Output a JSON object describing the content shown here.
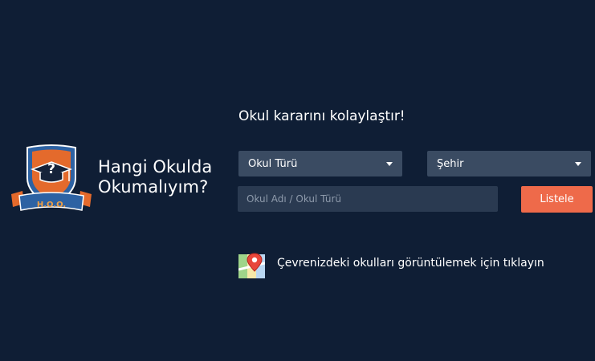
{
  "brand": {
    "logo_icon": "school-crest-logo-icon",
    "logo_text": "H.O.O.",
    "line1": "Hangi Okulda",
    "line2": "Okumalıyım?"
  },
  "search": {
    "tagline": "Okul kararını kolaylaştır!",
    "type_select_value": "Okul Türü",
    "city_select_value": "Şehir",
    "name_placeholder": "Okul Adı / Okul Türü",
    "submit_label": "Listele"
  },
  "nearby": {
    "icon": "map-pin-icon",
    "link_text": "Çevrenizdeki okulları görüntülemek için tıklayın"
  },
  "colors": {
    "background": "#0f1e35",
    "accent": "#ee6a4a",
    "select_bg": "#3a4b62",
    "input_bg": "#2a3a51"
  }
}
